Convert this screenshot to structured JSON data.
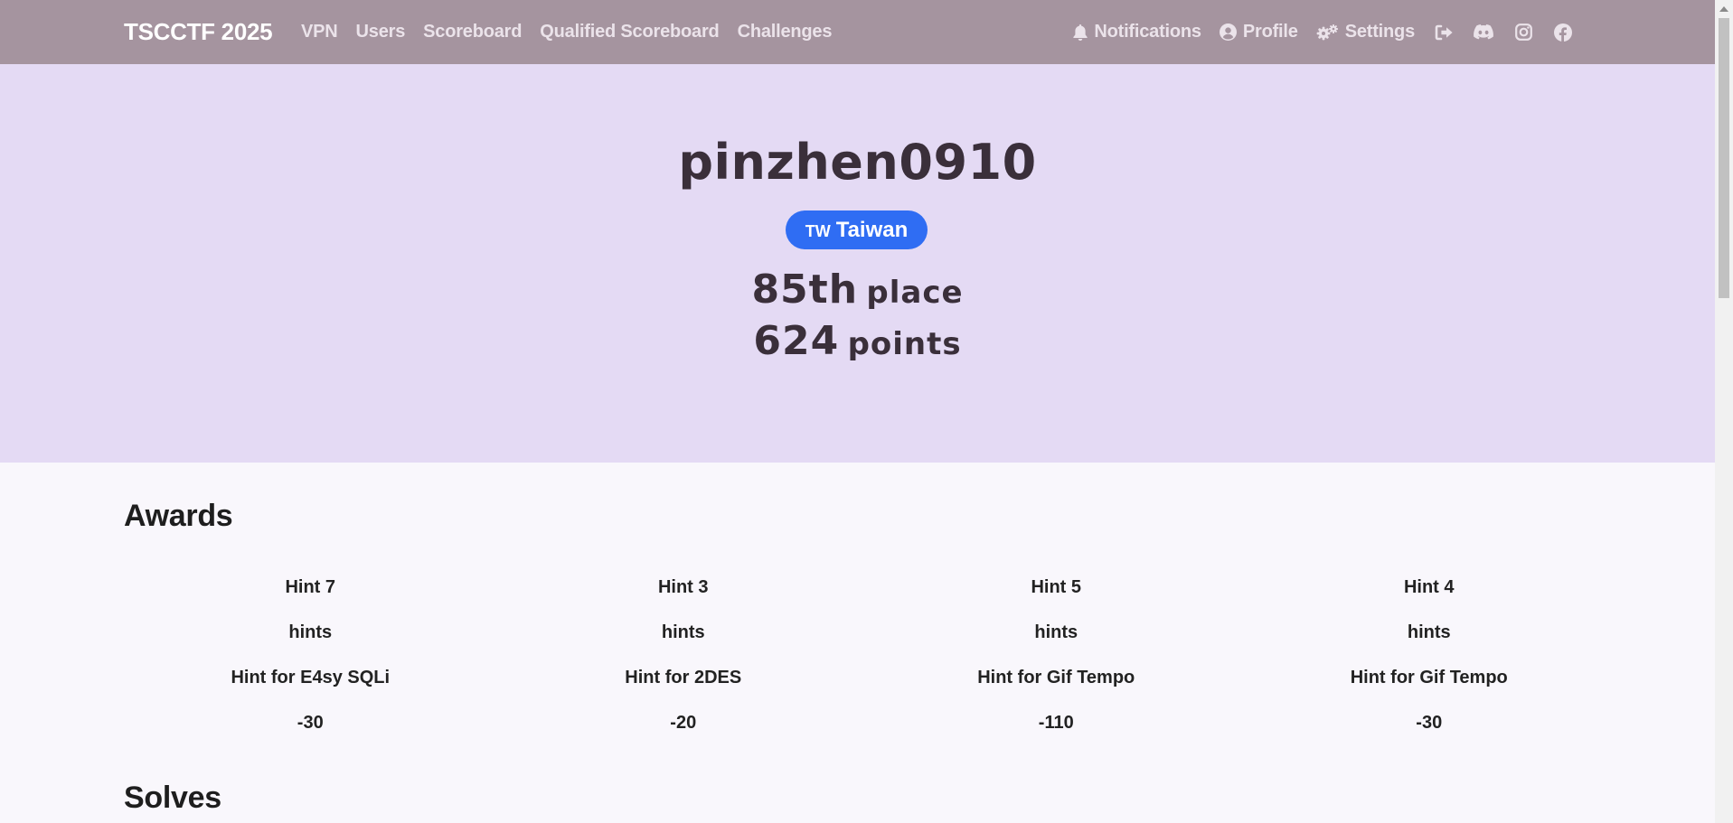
{
  "navbar": {
    "brand": "TSCCTF 2025",
    "links": [
      "VPN",
      "Users",
      "Scoreboard",
      "Qualified Scoreboard",
      "Challenges"
    ],
    "notifications": "Notifications",
    "profile": "Profile",
    "settings": "Settings",
    "icons": [
      "logout-icon",
      "discord-icon",
      "instagram-icon",
      "facebook-icon"
    ]
  },
  "user": {
    "name": "pinzhen0910",
    "country_code": "TW",
    "country": "Taiwan",
    "place_number": "85th",
    "place_label": "place",
    "points_number": "624",
    "points_label": "points"
  },
  "awards": {
    "title": "Awards",
    "items": [
      {
        "name": "Hint 7",
        "category": "hints",
        "description": "Hint for E4sy SQLi",
        "value": "-30"
      },
      {
        "name": "Hint 3",
        "category": "hints",
        "description": "Hint for 2DES",
        "value": "-20"
      },
      {
        "name": "Hint 5",
        "category": "hints",
        "description": "Hint for Gif Tempo",
        "value": "-110"
      },
      {
        "name": "Hint 4",
        "category": "hints",
        "description": "Hint for Gif Tempo",
        "value": "-30"
      }
    ]
  },
  "solves": {
    "title": "Solves"
  },
  "colors": {
    "navbar": "#a5949f",
    "jumbotron": "#e4daf4",
    "badge": "#2f6df3",
    "background": "#f9f7fc"
  }
}
